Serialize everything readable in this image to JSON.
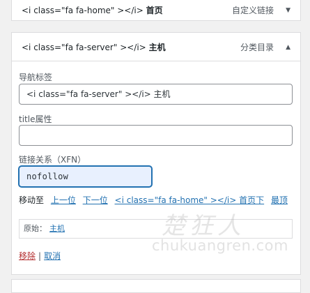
{
  "home_item": {
    "title_code": "<i class=\"fa fa-home\" ></i>",
    "title_text": "首页",
    "type": "自定义链接",
    "toggle_icon": "▼"
  },
  "server_item": {
    "title_code": "<i class=\"fa fa-server\" ></i>",
    "title_text": "主机",
    "type": "分类目录",
    "toggle_icon": "▲"
  },
  "settings": {
    "nav_label": {
      "label": "导航标签",
      "value": "<i class=\"fa fa-server\" ></i> 主机"
    },
    "title_attr": {
      "label": "title属性",
      "value": ""
    },
    "xfn": {
      "label": "链接关系（XFN）",
      "value": "nofollow"
    },
    "move": {
      "label": "移动至",
      "up_one": "上一位",
      "down_one": "下一位",
      "under": "<i class=\"fa fa-home\" ></i> 首页下",
      "top": "最顶"
    },
    "original": {
      "label": "原始：",
      "link": "主机"
    },
    "actions": {
      "delete": "移除",
      "separator": "|",
      "cancel": "取消"
    }
  },
  "watermark": {
    "cn": "楚狂人",
    "en": "chukuangren.com"
  },
  "colors": {
    "link": "#2271b1",
    "delete": "#b32d2e",
    "focus_bg": "#e8f0fe"
  }
}
